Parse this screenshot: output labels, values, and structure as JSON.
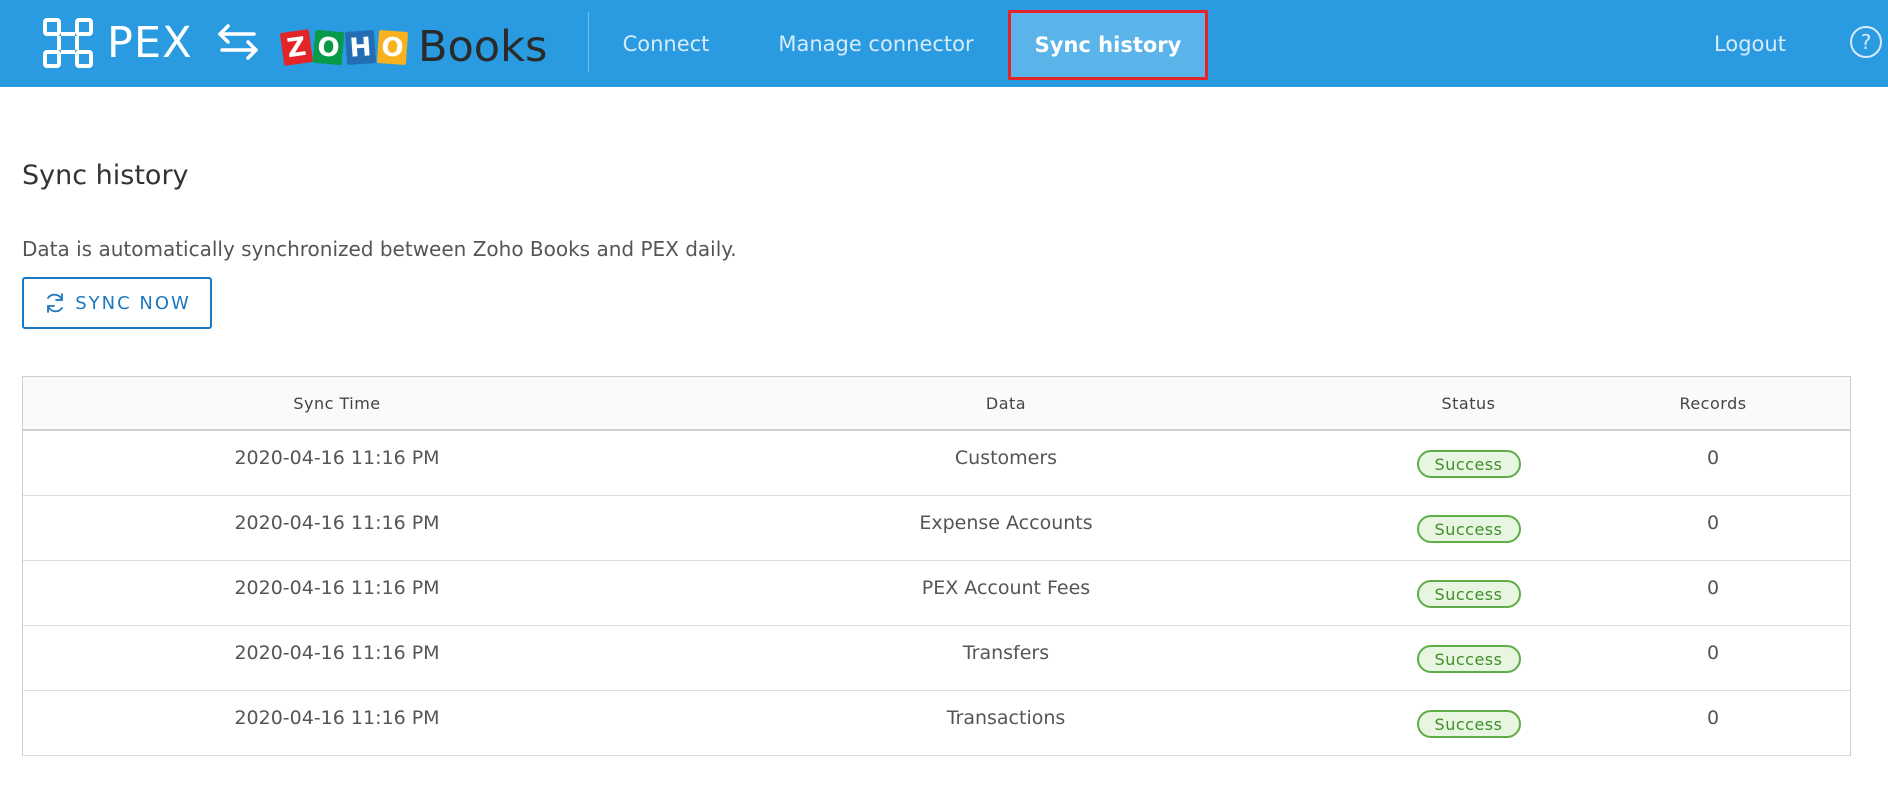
{
  "header": {
    "brand_left": "PEX",
    "brand_right_letters": [
      "Z",
      "O",
      "H",
      "O"
    ],
    "brand_right_product": "Books",
    "nav": {
      "connect": "Connect",
      "manage": "Manage connector",
      "sync_history": "Sync history",
      "logout": "Logout"
    },
    "help_icon": "question-circle-icon",
    "active_tab": "sync_history",
    "colors": {
      "bar": "#2a9be0",
      "active_tab": "#5ab4ea",
      "highlight_outline": "#e3242b"
    }
  },
  "main": {
    "title": "Sync history",
    "description": "Data is automatically synchronized between Zoho Books and PEX daily.",
    "sync_button": {
      "label": "SYNC NOW",
      "icon": "refresh-icon"
    }
  },
  "table": {
    "headers": [
      "Sync Time",
      "Data",
      "Status",
      "Records"
    ],
    "rows": [
      {
        "time": "2020-04-16 11:16 PM",
        "data": "Customers",
        "status": "Success",
        "records": "0"
      },
      {
        "time": "2020-04-16 11:16 PM",
        "data": "Expense Accounts",
        "status": "Success",
        "records": "0"
      },
      {
        "time": "2020-04-16 11:16 PM",
        "data": "PEX Account Fees",
        "status": "Success",
        "records": "0"
      },
      {
        "time": "2020-04-16 11:16 PM",
        "data": "Transfers",
        "status": "Success",
        "records": "0"
      },
      {
        "time": "2020-04-16 11:16 PM",
        "data": "Transactions",
        "status": "Success",
        "records": "0"
      }
    ],
    "status_colors": {
      "success_border": "#5fad47",
      "success_bg": "#e7f5e1"
    }
  }
}
